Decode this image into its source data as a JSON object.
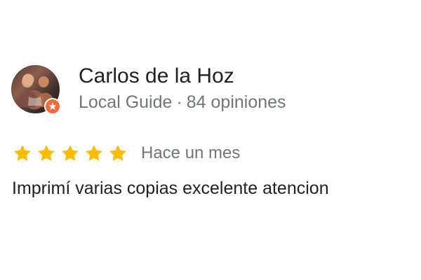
{
  "review": {
    "author": {
      "name": "Carlos de la Hoz",
      "guide_label": "Local Guide",
      "separator": "·",
      "reviews_count": "84 opiniones",
      "avatar_icon": "profile-photo",
      "badge_icon": "local-guide-star-icon"
    },
    "rating": {
      "stars": 5,
      "max_stars": 5,
      "star_color": "#fbbc04",
      "time_ago": "Hace un mes"
    },
    "text": "Imprimí varias copias excelente atencion"
  }
}
